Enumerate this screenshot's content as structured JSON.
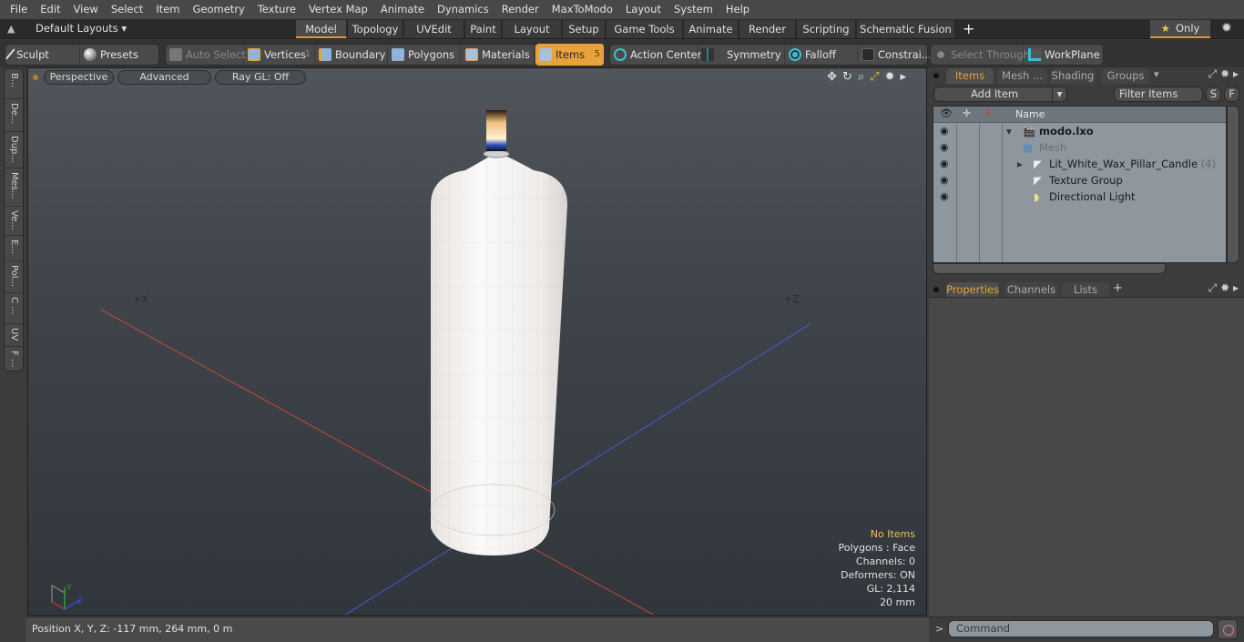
{
  "menubar": [
    "File",
    "Edit",
    "View",
    "Select",
    "Item",
    "Geometry",
    "Texture",
    "Vertex Map",
    "Animate",
    "Dynamics",
    "Render",
    "MaxToModo",
    "Layout",
    "System",
    "Help"
  ],
  "layoutbar": {
    "layouts_label": "Default Layouts",
    "tabs": [
      "Model",
      "Topology",
      "UVEdit",
      "Paint",
      "Layout",
      "Setup",
      "Game Tools",
      "Animate",
      "Render",
      "Scripting",
      "Schematic Fusion"
    ],
    "active_tab": "Model",
    "add_label": "+",
    "only_label": "Only"
  },
  "toolbar": {
    "sculpt": "Sculpt",
    "presets": "Presets",
    "auto_select": "Auto Select",
    "vertices": "Vertices",
    "vertices_count": "1",
    "boundary": "Boundary",
    "polygons": "Polygons",
    "materials": "Materials",
    "items": "Items",
    "items_count": "5",
    "action_center": "Action Center",
    "symmetry": "Symmetry",
    "falloff": "Falloff",
    "constraints": "Constrai...",
    "select_through": "Select Through",
    "workplane": "WorkPlane"
  },
  "left_tabs": [
    "B...",
    "De...",
    "Dup...",
    "Mes...",
    "Ve...",
    "E...",
    "Pol...",
    "C ...",
    "UV",
    "F ..."
  ],
  "viewport": {
    "view_mode": "Perspective",
    "shading": "Advanced",
    "raygl": "Ray GL: Off",
    "axis_x_label": "+X",
    "axis_z_label": "+Z",
    "hud": {
      "selection": "No Items",
      "polygons": "Polygons : Face",
      "channels": "Channels: 0",
      "deformers": "Deformers: ON",
      "gl": "GL: 2,114",
      "grid": "20 mm"
    },
    "colors": {
      "x_axis": "#c8483a",
      "z_axis": "#4a5ad0",
      "candle": "#f2f0ee"
    }
  },
  "status": {
    "position": "Position X, Y, Z:   -117 mm, 264 mm, 0 m"
  },
  "items_panel": {
    "tabs": [
      "Items",
      "Mesh ...",
      "Shading",
      "Groups"
    ],
    "active_tab": "Items",
    "add_item": "Add Item",
    "filter": "Filter Items",
    "s_btn": "S",
    "f_btn": "F",
    "col_name": "Name",
    "tree": [
      {
        "name": "modo.lxo",
        "bold": true
      },
      {
        "name": "Mesh",
        "dim": true
      },
      {
        "name": "Lit_White_Wax_Pillar_Candle",
        "count": "(4)"
      },
      {
        "name": "Texture Group"
      },
      {
        "name": "Directional Light"
      }
    ]
  },
  "properties_panel": {
    "tabs": [
      "Properties",
      "Channels",
      "Lists"
    ],
    "active_tab": "Properties",
    "add_label": "+"
  },
  "command": {
    "prompt": ">",
    "placeholder": "Command"
  }
}
